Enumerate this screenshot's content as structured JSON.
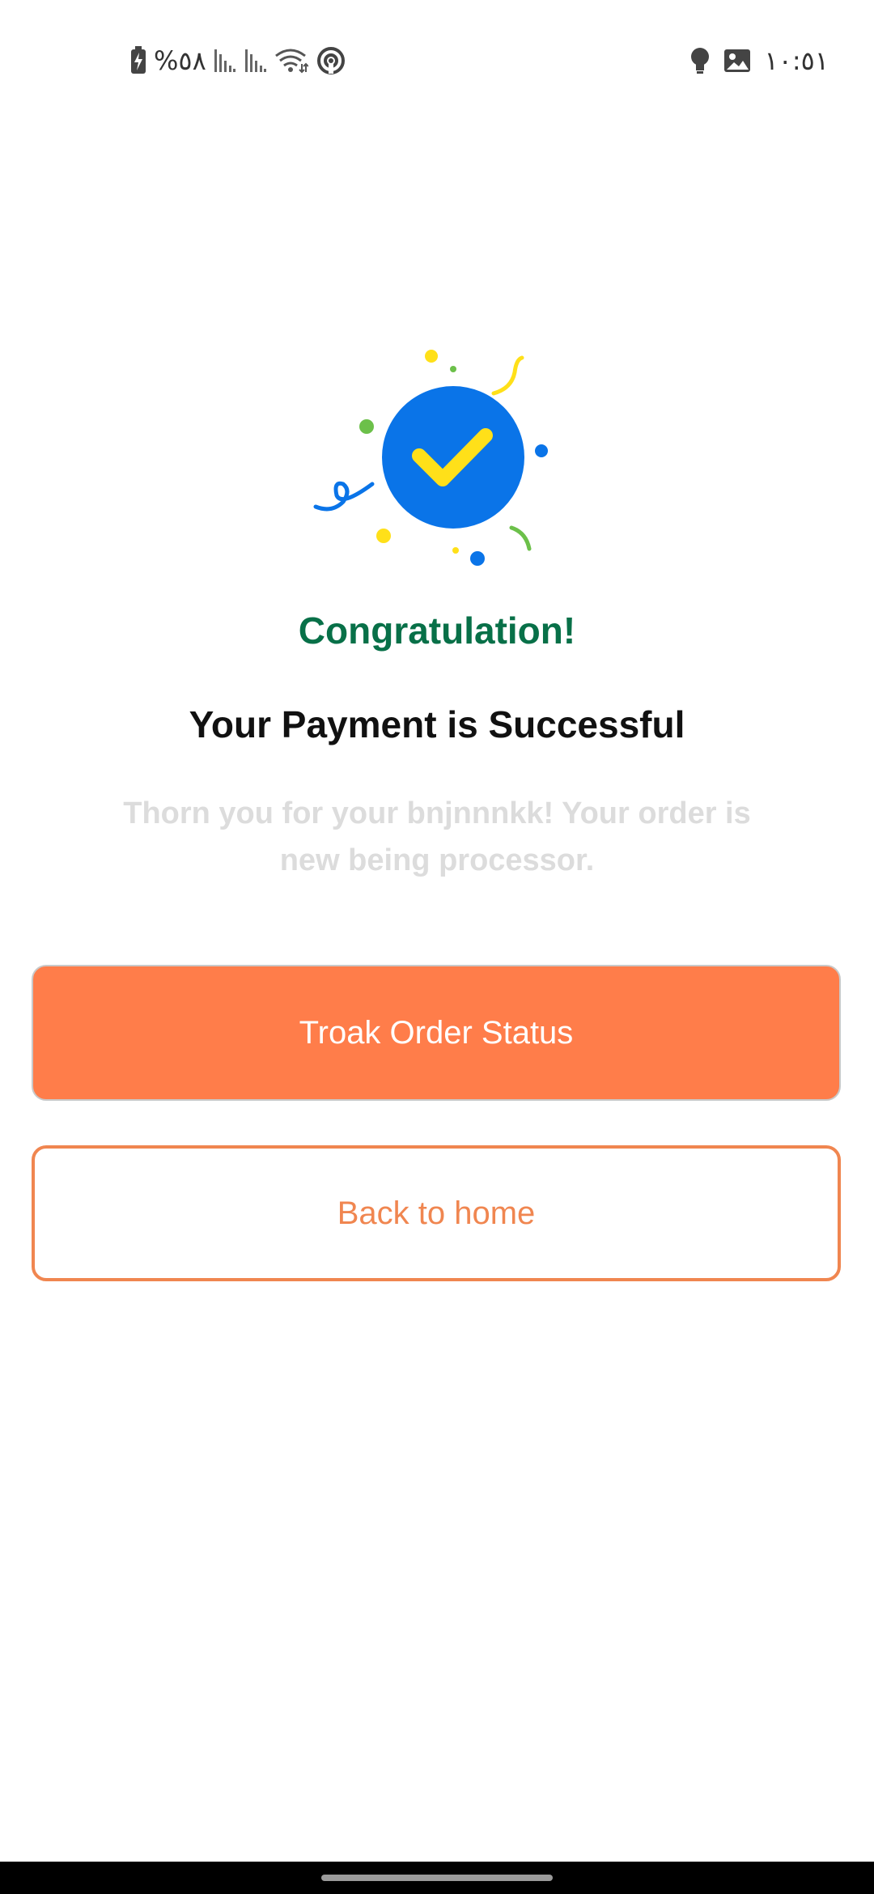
{
  "status_bar": {
    "battery_percent": "%٥٨",
    "time": "١٠:٥١",
    "icons": [
      "battery-charging-icon",
      "signal-icon",
      "signal-icon",
      "wifi-icon",
      "hotspot-icon",
      "bulb-icon",
      "image-icon"
    ]
  },
  "content": {
    "congrats": "Congratulation!",
    "headline": "Your Payment is Successful",
    "message": "Thorn you for your bnjnnnkk! Your order is new being processor."
  },
  "buttons": {
    "primary_label": "Troak Order Status",
    "secondary_label": "Back to home"
  },
  "colors": {
    "accent_orange": "#ff7d4a",
    "outline_orange": "#f08650",
    "congrats_green": "#087048",
    "check_circle_blue": "#0a74e8",
    "check_yellow": "#ffe019"
  }
}
